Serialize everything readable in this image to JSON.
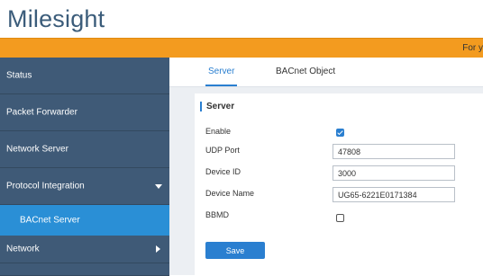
{
  "brand": {
    "name": "Milesight",
    "accent": "#f39b1f",
    "sidebar_bg": "#3f5a77",
    "active_blue": "#2a8fd6"
  },
  "notice": {
    "text": "For y"
  },
  "sidebar": {
    "items": [
      {
        "label": "Status"
      },
      {
        "label": "Packet Forwarder"
      },
      {
        "label": "Network Server"
      },
      {
        "label": "Protocol Integration",
        "expanded": true,
        "icon": "chevron-down-icon"
      },
      {
        "label": "BACnet Server",
        "active": true
      },
      {
        "label": "Network",
        "icon": "chevron-right-icon"
      }
    ]
  },
  "tabs": [
    {
      "label": "Server",
      "active": true
    },
    {
      "label": "BACnet Object",
      "active": false
    }
  ],
  "form": {
    "section_title": "Server",
    "enable": {
      "label": "Enable",
      "checked": true
    },
    "udp_port": {
      "label": "UDP Port",
      "value": "47808"
    },
    "device_id": {
      "label": "Device ID",
      "value": "3000"
    },
    "device_name": {
      "label": "Device Name",
      "value": "UG65-6221E0171384"
    },
    "bbmd": {
      "label": "BBMD",
      "checked": false
    },
    "save_label": "Save"
  }
}
